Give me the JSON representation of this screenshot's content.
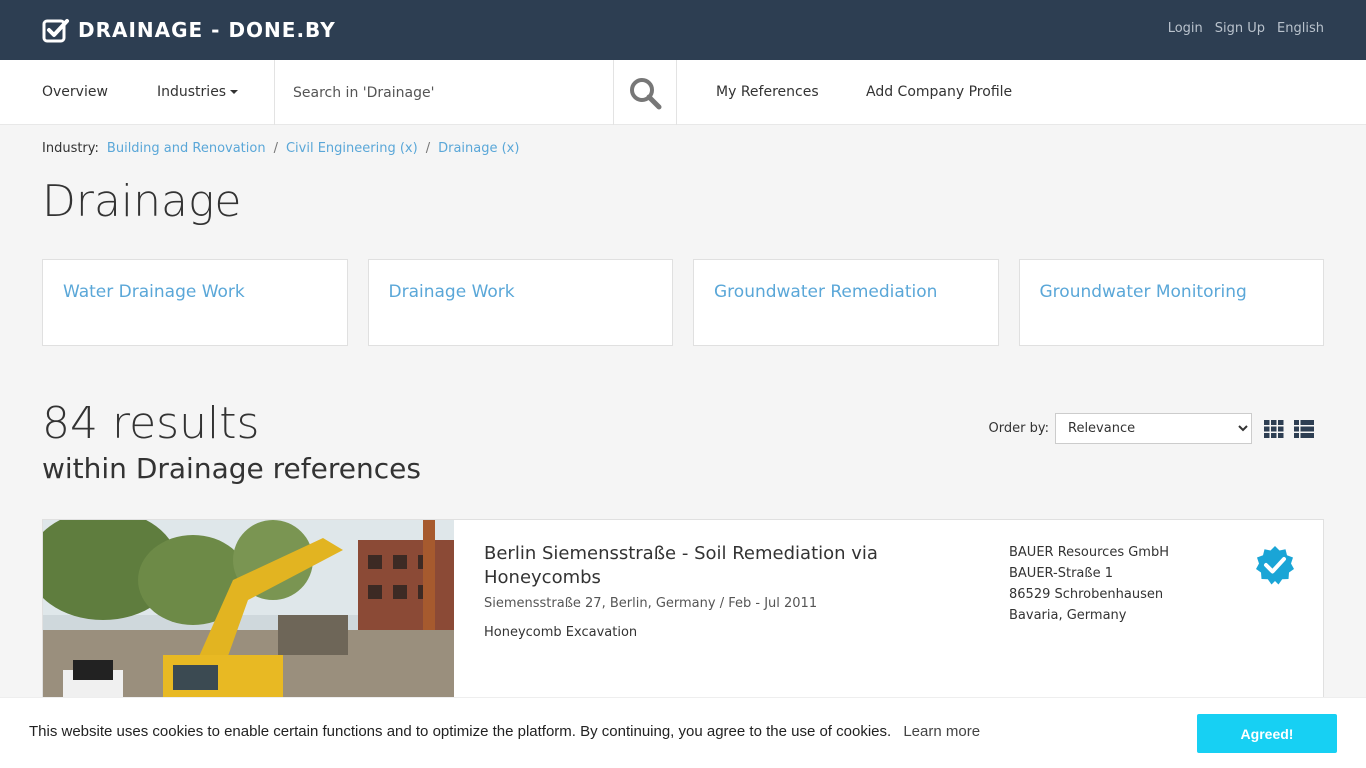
{
  "header": {
    "brand": "DRAINAGE - DONE.BY",
    "links": [
      "Login",
      "Sign Up",
      "English"
    ]
  },
  "nav": {
    "overview": "Overview",
    "industries": "Industries",
    "search_placeholder": "Search in 'Drainage'",
    "my_references": "My References",
    "add_company": "Add Company Profile"
  },
  "breadcrumb": {
    "label": "Industry:",
    "items": [
      "Building and Renovation",
      "Civil Engineering (x)",
      "Drainage (x)"
    ],
    "separator": "/"
  },
  "page_title": "Drainage",
  "sub_industries": [
    "Water Drainage Work",
    "Drainage Work",
    "Groundwater Remediation",
    "Groundwater Monitoring"
  ],
  "results": {
    "count": "84 results",
    "subtitle": "within Drainage references",
    "order_label": "Order by:",
    "order_selected": "Relevance"
  },
  "result_item": {
    "title": "Berlin Siemensstraße - Soil Remediation via Honeycombs",
    "location": "Siemensstraße 27, Berlin, Germany / Feb - Jul 2011",
    "tag": "Honeycomb Excavation",
    "company": {
      "name": "BAUER Resources GmbH",
      "street": "BAUER-Straße 1",
      "city": "86529 Schrobenhausen",
      "region": "Bavaria, Germany"
    },
    "verified_icon": "verified-badge-icon"
  },
  "cookie": {
    "text": "This website uses cookies to enable certain functions and to optimize the platform. By continuing, you agree to the use of cookies.",
    "learn_more": "Learn more",
    "button": "Agreed!"
  },
  "colors": {
    "topbar": "#2d3e52",
    "link": "#5aa7d8",
    "cookie_button": "#17d0f3",
    "verified": "#1aa5d6"
  }
}
